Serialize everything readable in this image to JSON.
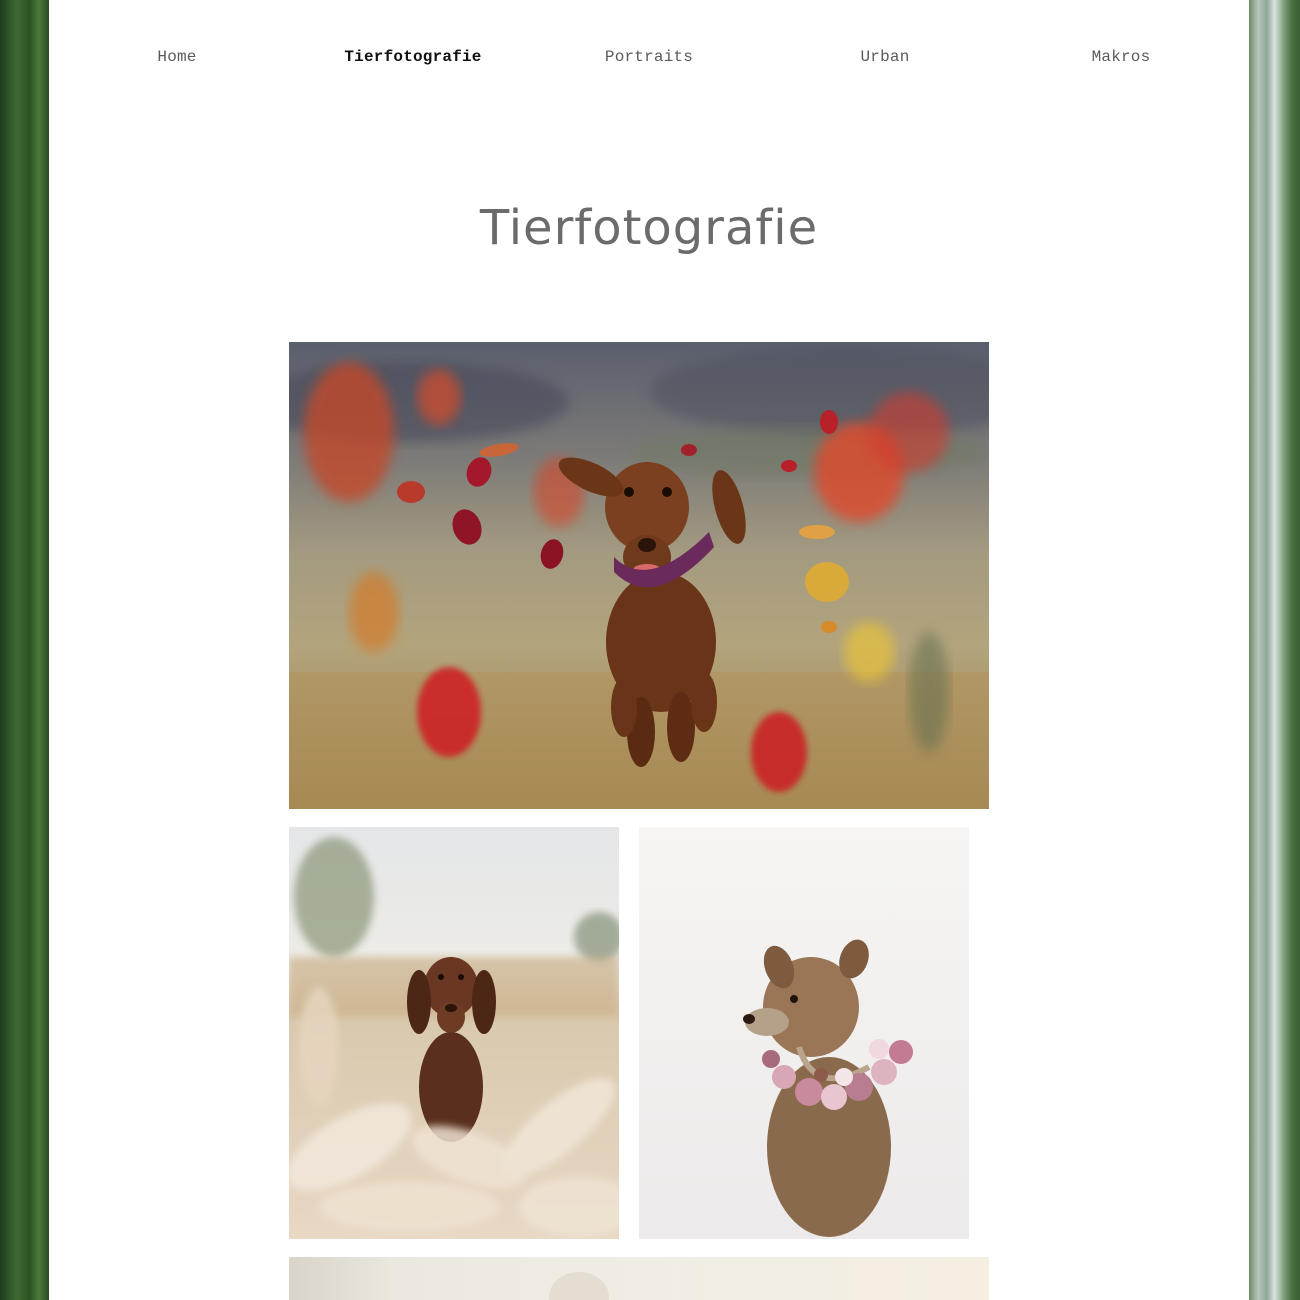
{
  "nav": {
    "items": [
      {
        "label": "Home",
        "active": false
      },
      {
        "label": "Tierfotografie",
        "active": true
      },
      {
        "label": "Portraits",
        "active": false
      },
      {
        "label": "Urban",
        "active": false
      },
      {
        "label": "Makros",
        "active": false
      }
    ]
  },
  "page": {
    "title": "Tierfotografie"
  },
  "gallery": {
    "photos": [
      {
        "subject": "dachshund-running-autumn-leaves"
      },
      {
        "subject": "dachshund-in-pampas-grass"
      },
      {
        "subject": "terrier-with-flower-collar"
      },
      {
        "subject": "bright-photo-partially-visible"
      }
    ]
  },
  "colors": {
    "nav_text": "#5a5a5a",
    "nav_active": "#111111",
    "title": "#6b6b6b",
    "background": "#ffffff"
  }
}
